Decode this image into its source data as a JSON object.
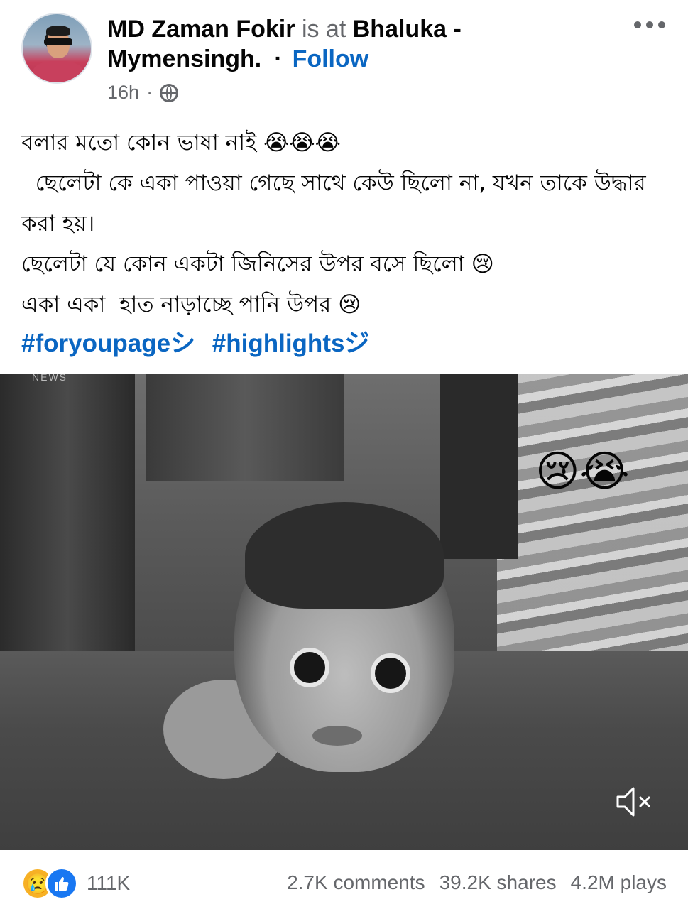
{
  "post": {
    "author": "MD Zaman Fokir",
    "connector": "is at",
    "location": "Bhaluka - Mymensingh.",
    "follow_label": "Follow",
    "time": "16h",
    "visibility_icon": "globe-icon",
    "more_icon": "more-options-icon",
    "text_lines": [
      "বলার মতো কোন ভাষা নাই 😭😭😭",
      "  ছেলেটা কে একা পাওয়া গেছে সাথে কেউ ছিলো না, যখন তাকে উদ্ধার করা হয়।",
      "ছেলেটা যে কোন একটা জিনিসের উপর বসে ছিলো 😢",
      "একা একা  হাত নাড়াচ্ছে পানি উপর 😢"
    ],
    "hashtags": [
      "#foryoupageシ",
      "#highlightsジ"
    ]
  },
  "video": {
    "overlay_emojis": "😢😭",
    "overlay_label": "NEWS",
    "mute_icon": "volume-muted-icon"
  },
  "footer": {
    "reaction_icons": [
      "sad-reaction-icon",
      "like-reaction-icon"
    ],
    "reaction_count": "111K",
    "comments": "2.7K comments",
    "shares": "39.2K shares",
    "plays": "4.2M plays"
  },
  "colors": {
    "link_blue": "#0a66c2",
    "muted_text": "#65676b",
    "text": "#050505"
  }
}
